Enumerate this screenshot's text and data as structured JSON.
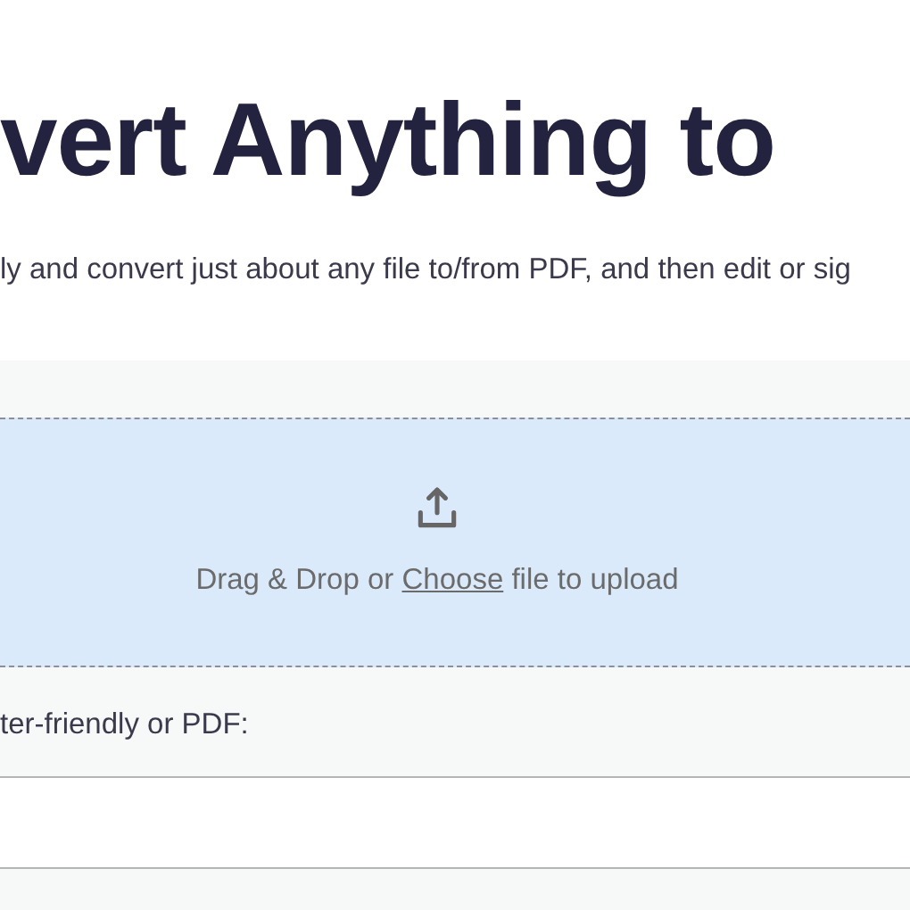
{
  "title": "vert Anything to",
  "subtitle": "ly and convert just about any file to/from PDF, and then edit or sig",
  "dropzone": {
    "before": "Drag & Drop or",
    "link": "Choose",
    "after": "file to upload"
  },
  "field": {
    "label": "ter-friendly or PDF:"
  }
}
